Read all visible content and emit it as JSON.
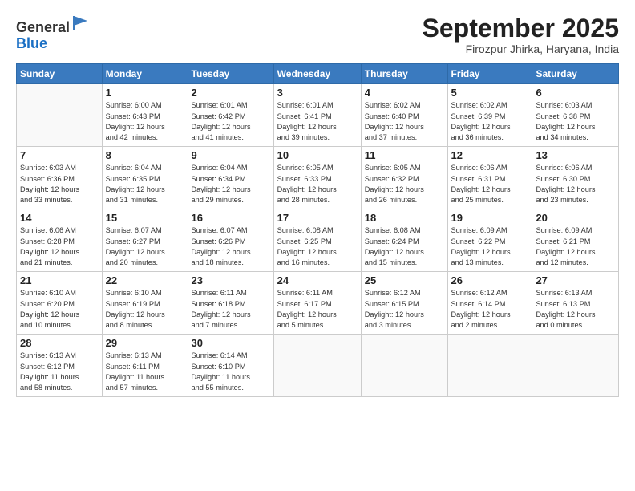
{
  "header": {
    "logo_general": "General",
    "logo_blue": "Blue",
    "month_title": "September 2025",
    "subtitle": "Firozpur Jhirka, Haryana, India"
  },
  "weekdays": [
    "Sunday",
    "Monday",
    "Tuesday",
    "Wednesday",
    "Thursday",
    "Friday",
    "Saturday"
  ],
  "weeks": [
    [
      {
        "day": "",
        "info": ""
      },
      {
        "day": "1",
        "info": "Sunrise: 6:00 AM\nSunset: 6:43 PM\nDaylight: 12 hours\nand 42 minutes."
      },
      {
        "day": "2",
        "info": "Sunrise: 6:01 AM\nSunset: 6:42 PM\nDaylight: 12 hours\nand 41 minutes."
      },
      {
        "day": "3",
        "info": "Sunrise: 6:01 AM\nSunset: 6:41 PM\nDaylight: 12 hours\nand 39 minutes."
      },
      {
        "day": "4",
        "info": "Sunrise: 6:02 AM\nSunset: 6:40 PM\nDaylight: 12 hours\nand 37 minutes."
      },
      {
        "day": "5",
        "info": "Sunrise: 6:02 AM\nSunset: 6:39 PM\nDaylight: 12 hours\nand 36 minutes."
      },
      {
        "day": "6",
        "info": "Sunrise: 6:03 AM\nSunset: 6:38 PM\nDaylight: 12 hours\nand 34 minutes."
      }
    ],
    [
      {
        "day": "7",
        "info": "Sunrise: 6:03 AM\nSunset: 6:36 PM\nDaylight: 12 hours\nand 33 minutes."
      },
      {
        "day": "8",
        "info": "Sunrise: 6:04 AM\nSunset: 6:35 PM\nDaylight: 12 hours\nand 31 minutes."
      },
      {
        "day": "9",
        "info": "Sunrise: 6:04 AM\nSunset: 6:34 PM\nDaylight: 12 hours\nand 29 minutes."
      },
      {
        "day": "10",
        "info": "Sunrise: 6:05 AM\nSunset: 6:33 PM\nDaylight: 12 hours\nand 28 minutes."
      },
      {
        "day": "11",
        "info": "Sunrise: 6:05 AM\nSunset: 6:32 PM\nDaylight: 12 hours\nand 26 minutes."
      },
      {
        "day": "12",
        "info": "Sunrise: 6:06 AM\nSunset: 6:31 PM\nDaylight: 12 hours\nand 25 minutes."
      },
      {
        "day": "13",
        "info": "Sunrise: 6:06 AM\nSunset: 6:30 PM\nDaylight: 12 hours\nand 23 minutes."
      }
    ],
    [
      {
        "day": "14",
        "info": "Sunrise: 6:06 AM\nSunset: 6:28 PM\nDaylight: 12 hours\nand 21 minutes."
      },
      {
        "day": "15",
        "info": "Sunrise: 6:07 AM\nSunset: 6:27 PM\nDaylight: 12 hours\nand 20 minutes."
      },
      {
        "day": "16",
        "info": "Sunrise: 6:07 AM\nSunset: 6:26 PM\nDaylight: 12 hours\nand 18 minutes."
      },
      {
        "day": "17",
        "info": "Sunrise: 6:08 AM\nSunset: 6:25 PM\nDaylight: 12 hours\nand 16 minutes."
      },
      {
        "day": "18",
        "info": "Sunrise: 6:08 AM\nSunset: 6:24 PM\nDaylight: 12 hours\nand 15 minutes."
      },
      {
        "day": "19",
        "info": "Sunrise: 6:09 AM\nSunset: 6:22 PM\nDaylight: 12 hours\nand 13 minutes."
      },
      {
        "day": "20",
        "info": "Sunrise: 6:09 AM\nSunset: 6:21 PM\nDaylight: 12 hours\nand 12 minutes."
      }
    ],
    [
      {
        "day": "21",
        "info": "Sunrise: 6:10 AM\nSunset: 6:20 PM\nDaylight: 12 hours\nand 10 minutes."
      },
      {
        "day": "22",
        "info": "Sunrise: 6:10 AM\nSunset: 6:19 PM\nDaylight: 12 hours\nand 8 minutes."
      },
      {
        "day": "23",
        "info": "Sunrise: 6:11 AM\nSunset: 6:18 PM\nDaylight: 12 hours\nand 7 minutes."
      },
      {
        "day": "24",
        "info": "Sunrise: 6:11 AM\nSunset: 6:17 PM\nDaylight: 12 hours\nand 5 minutes."
      },
      {
        "day": "25",
        "info": "Sunrise: 6:12 AM\nSunset: 6:15 PM\nDaylight: 12 hours\nand 3 minutes."
      },
      {
        "day": "26",
        "info": "Sunrise: 6:12 AM\nSunset: 6:14 PM\nDaylight: 12 hours\nand 2 minutes."
      },
      {
        "day": "27",
        "info": "Sunrise: 6:13 AM\nSunset: 6:13 PM\nDaylight: 12 hours\nand 0 minutes."
      }
    ],
    [
      {
        "day": "28",
        "info": "Sunrise: 6:13 AM\nSunset: 6:12 PM\nDaylight: 11 hours\nand 58 minutes."
      },
      {
        "day": "29",
        "info": "Sunrise: 6:13 AM\nSunset: 6:11 PM\nDaylight: 11 hours\nand 57 minutes."
      },
      {
        "day": "30",
        "info": "Sunrise: 6:14 AM\nSunset: 6:10 PM\nDaylight: 11 hours\nand 55 minutes."
      },
      {
        "day": "",
        "info": ""
      },
      {
        "day": "",
        "info": ""
      },
      {
        "day": "",
        "info": ""
      },
      {
        "day": "",
        "info": ""
      }
    ]
  ]
}
